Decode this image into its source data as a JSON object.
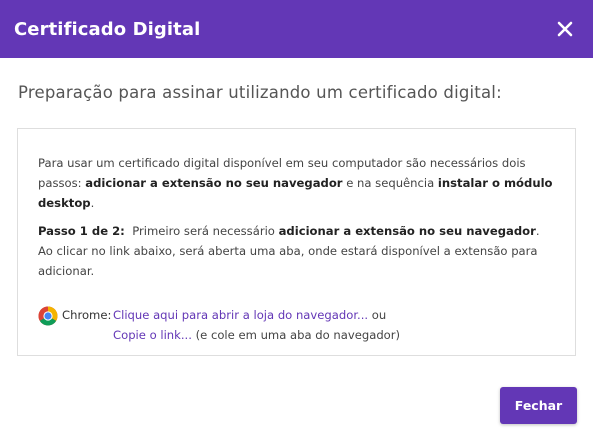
{
  "header": {
    "title": "Certificado Digital",
    "close_icon": "close-icon",
    "bg_color": "#6337b6"
  },
  "subtitle": "Preparação para assinar utilizando um certificado digital:",
  "intro": {
    "text1": "Para usar um certificado digital disponível em seu computador são necessários dois passos: ",
    "bold1": "adicionar a extensão no seu navegador",
    "text2": " e na sequência ",
    "bold2": "instalar o módulo desktop",
    "text3": "."
  },
  "step": {
    "label": "Passo 1 de 2:",
    "text1": "  Primeiro será necessário ",
    "bold": "adicionar a extensão no seu navegador",
    "text2": ". Ao clicar no link abaixo, será aberta uma aba, onde estará disponível a extensão para adicionar."
  },
  "chrome": {
    "icon": "chrome-icon",
    "label": "Chrome:",
    "store_link": "Clique aqui para abrir a loja do navegador...",
    "or_text": " ou",
    "copy_link": "Copie o link...",
    "copy_hint": " (e cole em uma aba do navegador)"
  },
  "footer": {
    "close_button": "Fechar"
  }
}
